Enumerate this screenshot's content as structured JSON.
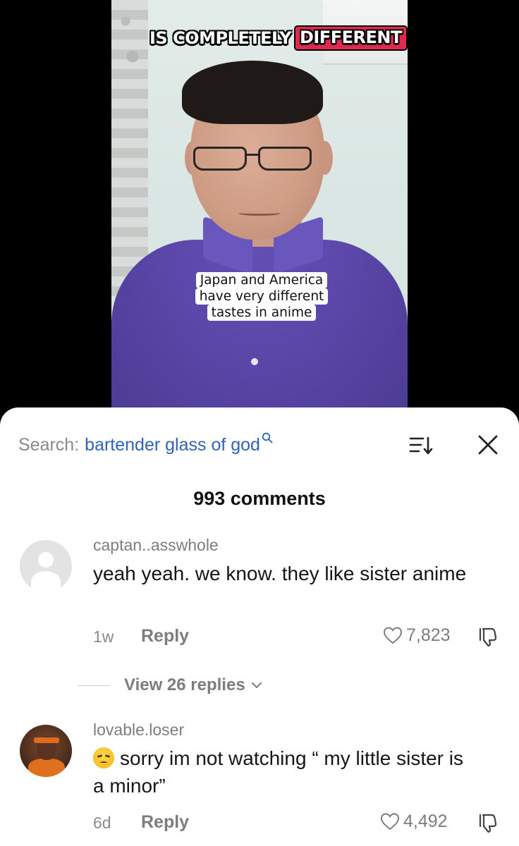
{
  "video": {
    "title_plain": "IS COMPLETELY",
    "title_highlight": "DIFFERENT",
    "caption_lines": [
      "Japan and America",
      "have very different",
      "tastes in anime"
    ]
  },
  "search": {
    "prefix": "Search:",
    "query": "bartender glass of god"
  },
  "comments_count": "993 comments",
  "comments": [
    {
      "username": "captan..asswhole",
      "text": "yeah yeah. we know. they like sister anime",
      "age": "1w",
      "reply_label": "Reply",
      "likes": "7,823",
      "view_replies": "View 26 replies"
    },
    {
      "username": "lovable.loser",
      "text": "sorry im not watching “ my little sister is a minor”",
      "emoji": "unamused-face",
      "age": "6d",
      "reply_label": "Reply",
      "likes": "4,492"
    }
  ],
  "colors": {
    "search_query": "#2e63b7",
    "title_badge": "#e0294e",
    "muted_text": "#7d7d7d"
  }
}
